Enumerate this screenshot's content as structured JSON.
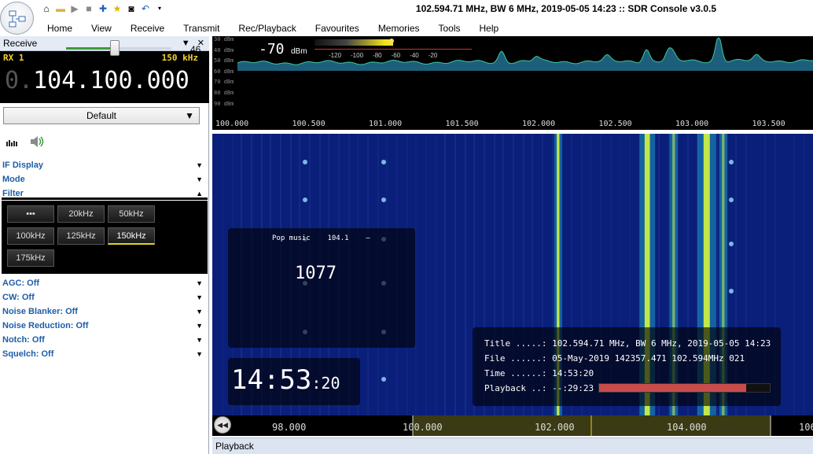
{
  "window": {
    "title": "102.594.71 MHz, BW 6 MHz, 2019-05-05 14:23 :: SDR Console v3.0.5"
  },
  "menu": [
    "Home",
    "View",
    "Receive",
    "Transmit",
    "Rec/Playback",
    "Favourites",
    "Memories",
    "Tools",
    "Help"
  ],
  "receive_panel": {
    "header": "Receive",
    "rx_label": "RX 1",
    "bandwidth": "150 kHz",
    "freq_prefix": "0.",
    "freq_main": "104.100.000",
    "preset": "Default",
    "volume": 46
  },
  "sections_top": [
    {
      "label": "IF Display",
      "expanded": false
    },
    {
      "label": "Mode",
      "expanded": false
    },
    {
      "label": "Filter",
      "expanded": true
    }
  ],
  "filter_buttons": [
    {
      "label": "•••",
      "selected": false
    },
    {
      "label": "20kHz",
      "selected": false
    },
    {
      "label": "50kHz",
      "selected": false
    },
    {
      "label": "100kHz",
      "selected": false
    },
    {
      "label": "125kHz",
      "selected": false
    },
    {
      "label": "150kHz",
      "selected": true
    },
    {
      "label": "175kHz",
      "selected": false
    }
  ],
  "sections_bottom": [
    {
      "label": "AGC: Off"
    },
    {
      "label": "CW: Off"
    },
    {
      "label": "Noise Blanker: Off"
    },
    {
      "label": "Noise Reduction: Off"
    },
    {
      "label": "Notch: Off"
    },
    {
      "label": "Squelch: Off"
    }
  ],
  "spectrum": {
    "dbm_scale": [
      "30 dBm",
      "40 dBm",
      "50 dBm",
      "60 dBm",
      "70 dBm",
      "80 dBm",
      "90 dBm"
    ],
    "dbm_reading": "-70",
    "dbm_unit": "dBm",
    "level_ticks": [
      "-120",
      "-100",
      "-80",
      "-60",
      "-40",
      "-20"
    ],
    "freq_axis": [
      "100.000",
      "100.500",
      "101.000",
      "101.500",
      "102.000",
      "102.500",
      "103.000",
      "103.500"
    ],
    "color_trace": "#3cc7a0",
    "color_fill": "#1d5f7a"
  },
  "waterfall": {
    "color_bg": "#0a1f7a",
    "color_line": "#e0ff3a",
    "lines_mhz": [
      102.2,
      103.55,
      104.45,
      103.95,
      104.7
    ],
    "axis_labels": [
      "98.000",
      "100.000",
      "102.000",
      "104.000",
      "106"
    ]
  },
  "radio_overlay": {
    "station": "Pop music",
    "freq": "104.1",
    "sep": "–",
    "value": "1077"
  },
  "clock": {
    "hm": "14:53",
    "sec": ":20"
  },
  "playback_info": {
    "title_label": "Title .....:",
    "title_value": "102.594.71 MHz, BW 6 MHz, 2019-05-05 14:23",
    "file_label": "File ......:",
    "file_value": "05-May-2019 142357.471 102.594MHz 021",
    "time_label": "Time ......:",
    "time_value": "14:53:20",
    "playback_label": "Playback ..:",
    "playback_value": "--:29:23",
    "progress": 0.86,
    "progress_color": "#c84c4c"
  },
  "statusbar": {
    "label": "Playback"
  }
}
